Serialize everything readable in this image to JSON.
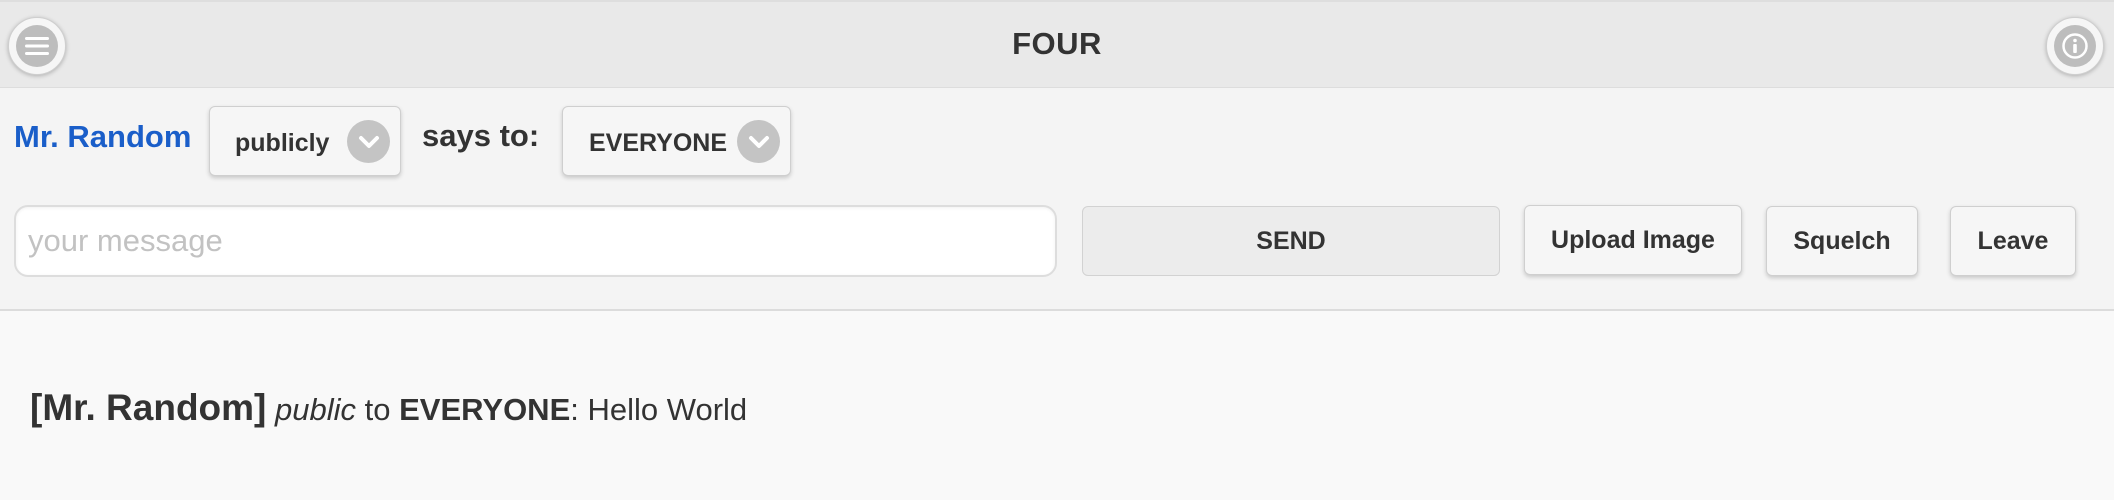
{
  "header": {
    "title": "FOUR",
    "menu_icon": "hamburger-menu-icon",
    "info_icon": "info-icon"
  },
  "composer": {
    "sender_name": "Mr. Random",
    "visibility_select": {
      "value": "publicly",
      "icon": "chevron-down-icon"
    },
    "says_to_label": "says to:",
    "recipient_select": {
      "value": "EVERYONE",
      "icon": "chevron-down-icon"
    },
    "message_input": {
      "value": "",
      "placeholder": "your message"
    },
    "send_label": "SEND",
    "upload_label": "Upload Image",
    "squelch_label": "Squelch",
    "leave_label": "Leave"
  },
  "messages": [
    {
      "sender": "[Mr. Random]",
      "mode": "public",
      "connector": "to",
      "recipient": "EVERYONE",
      "separator": ":",
      "text": "Hello World"
    }
  ],
  "colors": {
    "sender_name": "#1a5ec9",
    "header_bg": "#e9e9e9",
    "icon_bg": "#bdbdbd"
  }
}
